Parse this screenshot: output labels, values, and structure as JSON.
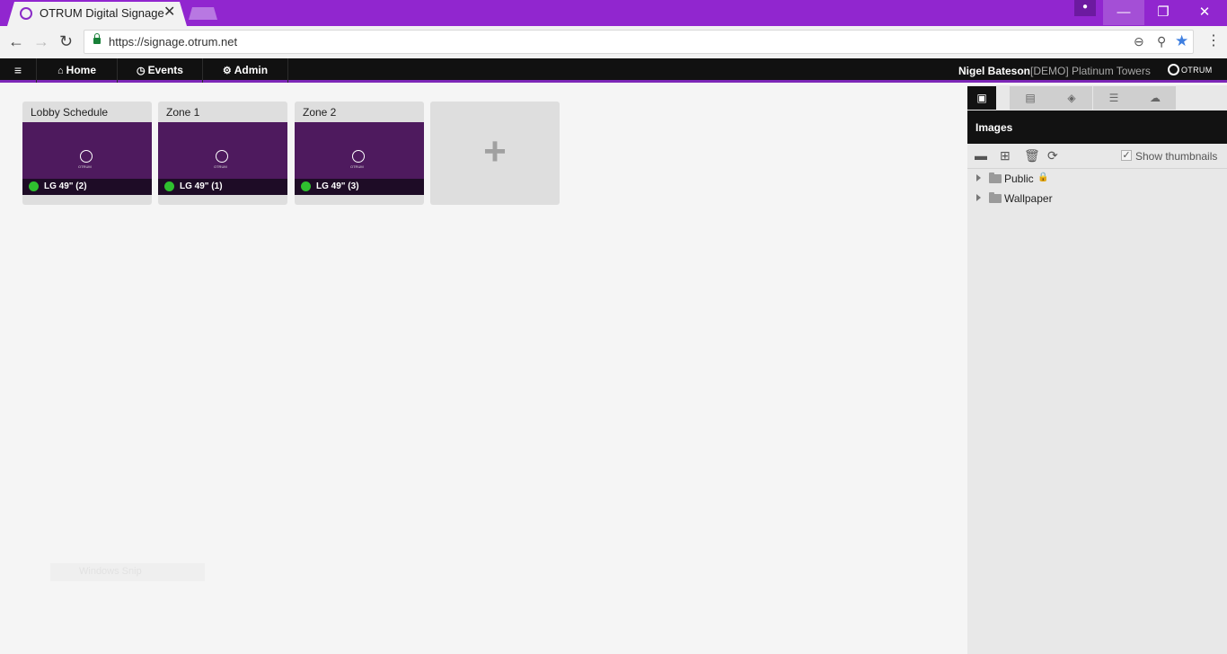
{
  "browser": {
    "tab_title": "OTRUM Digital Signage",
    "tab_close": "✕",
    "url": "https://signage.otrum.net",
    "window_min": "—",
    "window_restore": "❐",
    "window_close": "✕",
    "profile_icon": "person-icon",
    "theme_color": "#9126cf"
  },
  "appnav": {
    "menu_glyph": "≡",
    "items": [
      {
        "label": "Home",
        "icon": "home-icon"
      },
      {
        "label": "Events",
        "icon": "clock-icon"
      },
      {
        "label": "Admin",
        "icon": "cogs-icon"
      }
    ],
    "user_name": "Nigel Bateson",
    "site_name": "[DEMO] Platinum Towers",
    "brand": "OTRUM",
    "accent_color": "#7d27b8"
  },
  "zones": [
    {
      "title": "Lobby Schedule",
      "screen": "LG 49\" (2)",
      "status": "online"
    },
    {
      "title": "Zone 1",
      "screen": "LG 49\" (1)",
      "status": "online"
    },
    {
      "title": "Zone 2",
      "screen": "LG 49\" (3)",
      "status": "online"
    }
  ],
  "zone_logo_text": "OTRUM",
  "add_zone_glyph": "+",
  "faded_text": "Windows Snip",
  "panel": {
    "tabs": [
      {
        "icon": "image-icon",
        "active": true
      },
      {
        "icon": "film-icon",
        "active": false
      },
      {
        "icon": "cube-icon",
        "active": false
      },
      {
        "icon": "list-icon",
        "active": false
      },
      {
        "icon": "cloud-download-icon",
        "active": false
      }
    ],
    "title": "Images",
    "show_thumbnails_label": "Show thumbnails",
    "show_thumbnails_checked": true,
    "folders": [
      {
        "label": "Public",
        "locked": true
      },
      {
        "label": "Wallpaper",
        "locked": false
      }
    ]
  }
}
